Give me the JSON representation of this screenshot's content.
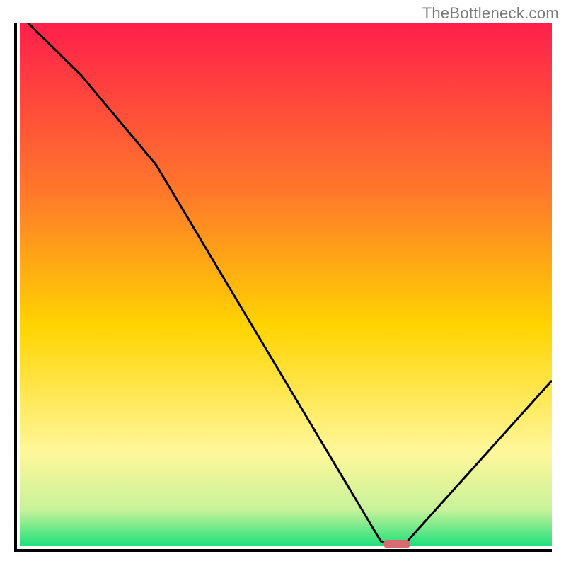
{
  "watermark": "TheBottleneck.com",
  "colors": {
    "gradient_top": "#ff1f4b",
    "gradient_mid_upper": "#ff7a2a",
    "gradient_mid": "#ffd400",
    "gradient_mid_lower": "#fff79a",
    "gradient_bottom": "#1ee07a",
    "axis": "#000000",
    "curve": "#000000",
    "marker": "#d86b6f",
    "background": "#ffffff"
  },
  "chart_data": {
    "type": "line",
    "title": "",
    "xlabel": "",
    "ylabel": "",
    "xlim": [
      0,
      100
    ],
    "ylim": [
      0,
      100
    ],
    "grid": false,
    "series": [
      {
        "name": "bottleneck-curve",
        "x": [
          2,
          12,
          26,
          68,
          70,
          73,
          100
        ],
        "values": [
          100,
          90,
          73,
          1.5,
          1.0,
          1.5,
          32
        ]
      }
    ],
    "annotations": [
      {
        "name": "optimal-marker",
        "x_start": 68,
        "x_end": 73,
        "y": 1.0
      }
    ],
    "gradient_stops": [
      {
        "pct": 0,
        "color": "#ff1f4b"
      },
      {
        "pct": 33,
        "color": "#ff7a2a"
      },
      {
        "pct": 58,
        "color": "#ffd400"
      },
      {
        "pct": 82,
        "color": "#fff79a"
      },
      {
        "pct": 93,
        "color": "#c8f29a"
      },
      {
        "pct": 100,
        "color": "#1ee07a"
      }
    ]
  }
}
